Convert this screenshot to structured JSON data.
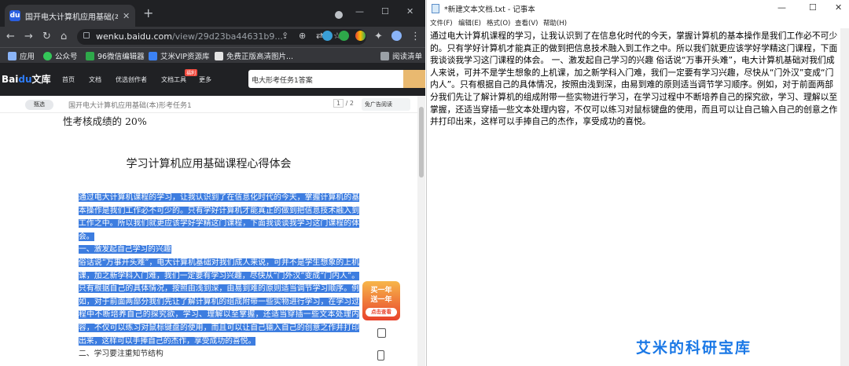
{
  "browser": {
    "tab_title": "国开电大计算机应用基础(本)形考任务1",
    "new_tab": "+",
    "url_domain": "wenku.baidu.com",
    "url_path": "/view/29d23ba44631b9...",
    "bookmarks": [
      "应用",
      "公众号",
      "96微信编辑器",
      "艾米VIP资源库",
      "免费正版高清图片...",
      "阅读清单"
    ]
  },
  "wenku": {
    "logo_text": "Bai",
    "logo_blue": "du",
    "logo_suffix": "文库",
    "nav": [
      "首页",
      "文档",
      "优选创作者",
      "文档工具",
      "更多"
    ],
    "hot_badge": "福利",
    "search_value": "电大形考任务1答案",
    "badge": "甄选",
    "doc_title": "国开电大计算机应用基础(本)形考任务1",
    "page_current": "1",
    "page_total": "/ 2",
    "adfree": "免广告阅读",
    "promo_line1": "买一年",
    "promo_line2": "送一年",
    "promo_btn": "点击查看"
  },
  "document": {
    "line0": "性考核成绩的 20%",
    "heading": "学习计算机应用基础课程心得体会",
    "p1": "通过电大计算机课程的学习，让我认识到了在信息化时代的今天，掌握计算机的基本操作是我们工作必不可少的。只有学好计算机才能真正的做到把信息技术融入到工作之中。所以我们就更应该学好学精这门课程，下面我谈谈我学习这门课程的体会。",
    "p2": "一、激发起自己学习的兴趣",
    "p3": "俗话说“万事开头难”，电大计算机基础对我们成人来说，可并不是学生想象的上机课，加之新学科入门难，我们一定要有学习兴趣，尽快从“门外汉”变成“门内人”。只有根据自己的具体情况，按照由浅到深，由易到难的原则适当调节学习顺序。例如，对于前面两部分我们先让了解计算机的组成附带一些实物进行学习，在学习过程中不断培养自己的探究欲，学习、理解以至掌握，还适当穿插一些文本处理内容，不仅可以练习对鼠标键盘的使用，而且可以让自己输入自己的创意之作并打印出来，这样可以手捧自己的杰作，享受成功的喜悦。",
    "p4": "二、学习要注重知节结构"
  },
  "notepad": {
    "title": "*新建文本文档.txt - 记事本",
    "menus": [
      "文件(F)",
      "编辑(E)",
      "格式(O)",
      "查看(V)",
      "帮助(H)"
    ],
    "content": "通过电大计算机课程的学习，让我认识到了在信息化时代的今天，掌握计算机的基本操作是我们工作必不可少的。只有学好计算机才能真正的做到把信息技术融入到工作之中。所以我们就更应该学好学精这门课程，下面我谈谈我学习这门课程的体会。 一、激发起自己学习的兴趣 俗话说“万事开头难”，电大计算机基础对我们成人来说，可并不是学生想象的上机课，加之新学科入门难，我们一定要有学习兴趣，尽快从“门外汉”变成“门内人”。只有根据自己的具体情况，按照由浅到深，由易到难的原则适当调节学习顺序。例如，对于前面两部分我们先让了解计算机的组成附带一些实物进行学习，在学习过程中不断培养自己的探究欲，学习、理解以至掌握，还适当穿插一些文本处理内容，不仅可以练习对鼠标键盘的使用，而且可以让自己输入自己的创意之作并打印出来，这样可以手捧自己的杰作，享受成功的喜悦。"
  },
  "watermark": "艾米的科研宝库"
}
